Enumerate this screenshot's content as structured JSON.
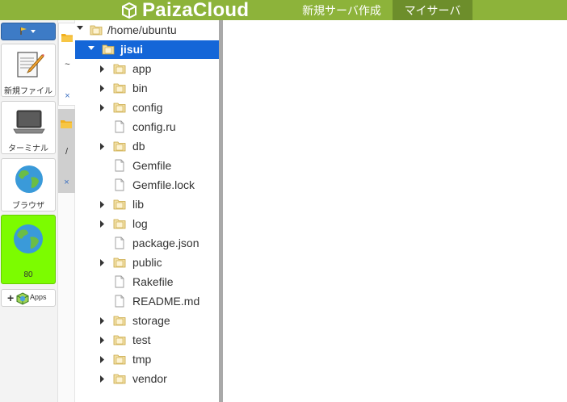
{
  "header": {
    "brand": "PaizaCloud",
    "nav_new_server": "新規サーバ作成",
    "nav_my_server": "マイサーバ"
  },
  "colors": {
    "brand_green": "#8db33a",
    "nav_active": "#6d8e2b",
    "menu_blue": "#3d7bc6",
    "selection_blue": "#1466d8",
    "browser_active": "#7cfc00"
  },
  "toolbar": {
    "new_file_label": "新規ファイル",
    "terminal_label": "ターミナル",
    "browser_label": "ブラウザ",
    "port_label": "80",
    "apps_label": "Apps"
  },
  "tabs": {
    "group1": {
      "folder_icon": "folder-icon",
      "name": "~",
      "close": "×"
    },
    "group2": {
      "folder_icon": "folder-icon",
      "name": "/",
      "close": "×"
    }
  },
  "tree": {
    "root": "/home/ubuntu",
    "selected": "jisui",
    "items": [
      {
        "name": "app",
        "type": "folder"
      },
      {
        "name": "bin",
        "type": "folder"
      },
      {
        "name": "config",
        "type": "folder"
      },
      {
        "name": "config.ru",
        "type": "file"
      },
      {
        "name": "db",
        "type": "folder"
      },
      {
        "name": "Gemfile",
        "type": "file"
      },
      {
        "name": "Gemfile.lock",
        "type": "file"
      },
      {
        "name": "lib",
        "type": "folder"
      },
      {
        "name": "log",
        "type": "folder"
      },
      {
        "name": "package.json",
        "type": "file"
      },
      {
        "name": "public",
        "type": "folder"
      },
      {
        "name": "Rakefile",
        "type": "file"
      },
      {
        "name": "README.md",
        "type": "file"
      },
      {
        "name": "storage",
        "type": "folder"
      },
      {
        "name": "test",
        "type": "folder"
      },
      {
        "name": "tmp",
        "type": "folder"
      },
      {
        "name": "vendor",
        "type": "folder"
      }
    ]
  }
}
